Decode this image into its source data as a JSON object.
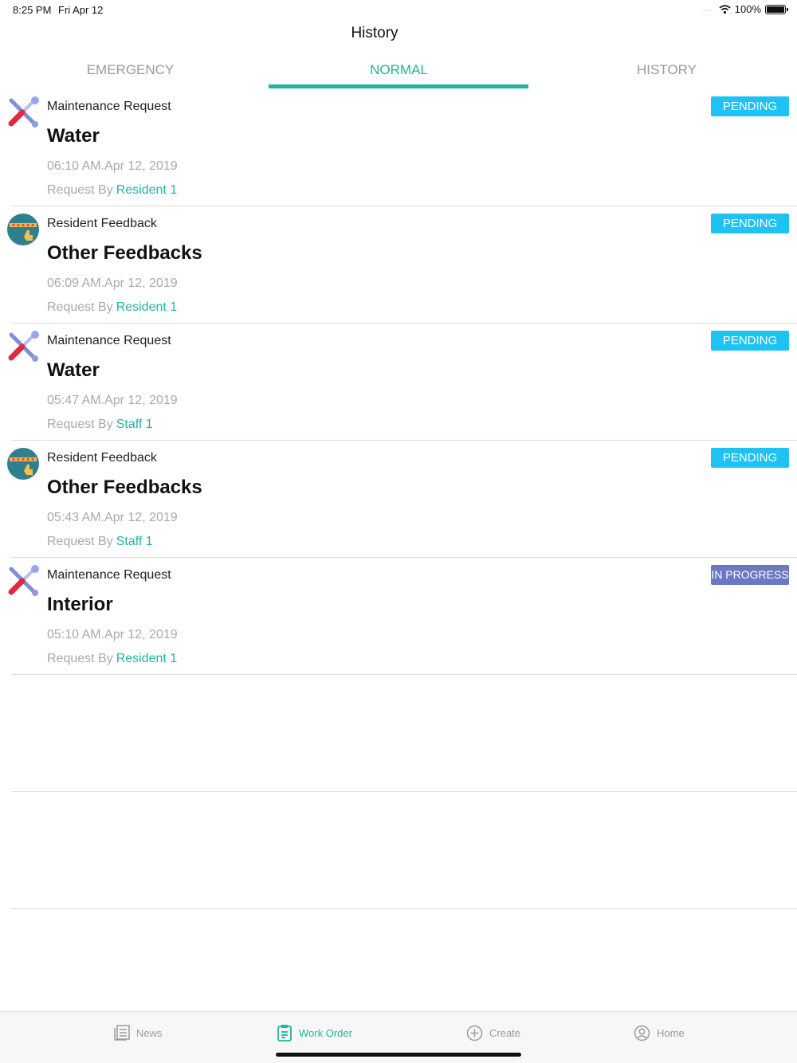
{
  "status_bar": {
    "time": "8:25 PM",
    "date": "Fri Apr 12",
    "battery": "100%",
    "signal": "....",
    "wifi_icon": "wifi-icon",
    "battery_icon": "battery-icon"
  },
  "nav": {
    "title": "History"
  },
  "tabs": [
    {
      "label": "EMERGENCY",
      "active": false
    },
    {
      "label": "NORMAL",
      "active": true
    },
    {
      "label": "HISTORY",
      "active": false
    }
  ],
  "requests": [
    {
      "category": "Maintenance Request",
      "icon": "tools-icon",
      "title": "Water",
      "time": "06:10 AM.Apr 12, 2019",
      "by_label": "Request By",
      "by": "Resident 1",
      "status": "PENDING"
    },
    {
      "category": "Resident Feedback",
      "icon": "feedback-icon",
      "title": "Other Feedbacks",
      "time": "06:09 AM.Apr 12, 2019",
      "by_label": "Request By",
      "by": "Resident 1",
      "status": "PENDING"
    },
    {
      "category": "Maintenance Request",
      "icon": "tools-icon",
      "title": "Water",
      "time": "05:47 AM.Apr 12, 2019",
      "by_label": "Request By",
      "by": "Staff 1",
      "status": "PENDING"
    },
    {
      "category": "Resident Feedback",
      "icon": "feedback-icon",
      "title": "Other Feedbacks",
      "time": "05:43 AM.Apr 12, 2019",
      "by_label": "Request By",
      "by": "Staff 1",
      "status": "PENDING"
    },
    {
      "category": "Maintenance Request",
      "icon": "tools-icon",
      "title": "Interior",
      "time": "05:10 AM.Apr 12, 2019",
      "by_label": "Request By",
      "by": "Resident 1",
      "status": "IN PROGRESS"
    }
  ],
  "colors": {
    "accent": "#1fb5a0",
    "pending": "#1ec3f3",
    "in_progress": "#6c78c4"
  },
  "tabbar": [
    {
      "label": "News",
      "icon": "news-icon",
      "active": false
    },
    {
      "label": "Work Order",
      "icon": "clipboard-icon",
      "active": true
    },
    {
      "label": "Create",
      "icon": "plus-circle-icon",
      "active": false
    },
    {
      "label": "Home",
      "icon": "user-circle-icon",
      "active": false
    }
  ]
}
